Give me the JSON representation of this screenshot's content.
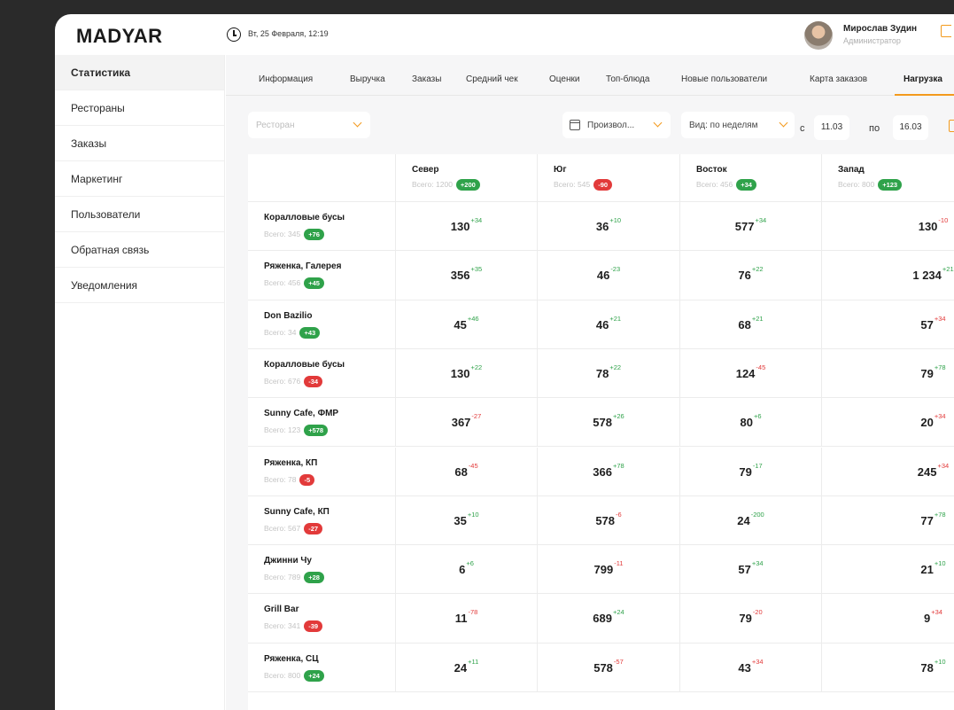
{
  "header": {
    "logo": "MADYAR",
    "date": "Вт, 25 Февраля, 12:19",
    "user_name": "Мирослав Зудин",
    "user_role": "Администратор"
  },
  "sidebar": {
    "items": [
      {
        "label": "Статистика",
        "active": true
      },
      {
        "label": "Рестораны"
      },
      {
        "label": "Заказы"
      },
      {
        "label": "Маркетинг"
      },
      {
        "label": "Пользователи"
      },
      {
        "label": "Обратная связь"
      },
      {
        "label": "Уведомления"
      }
    ]
  },
  "tabs": [
    "Информация",
    "Выручка",
    "Заказы",
    "Средний чек",
    "Оценки",
    "Топ-блюда",
    "Новые пользователи",
    "Карта заказов",
    "Нагрузка"
  ],
  "active_tab": "Нагрузка",
  "filters": {
    "restaurant_placeholder": "Ресторан",
    "period": "Произвол...",
    "view": "Вид: по неделям",
    "from_label": "с",
    "from": "11.03",
    "to_label": "по",
    "to": "16.03"
  },
  "columns": [
    {
      "name": "Север",
      "total": "Всего: 1200",
      "delta": "+200",
      "sign": "pos"
    },
    {
      "name": "Юг",
      "total": "Всего: 545",
      "delta": "-90",
      "sign": "neg"
    },
    {
      "name": "Восток",
      "total": "Всего: 456",
      "delta": "+34",
      "sign": "pos"
    },
    {
      "name": "Запад",
      "total": "Всего: 800",
      "delta": "+123",
      "sign": "pos"
    }
  ],
  "rows": [
    {
      "name": "Коралловые бусы",
      "total": "Всего: 345",
      "delta": "+76",
      "sign": "pos",
      "cells": [
        [
          "130",
          "+34",
          "pos"
        ],
        [
          "36",
          "+10",
          "pos"
        ],
        [
          "577",
          "+34",
          "pos"
        ],
        [
          "130",
          "-10",
          "neg"
        ]
      ]
    },
    {
      "name": "Ряженка, Галерея",
      "total": "Всего: 456",
      "delta": "+45",
      "sign": "pos",
      "cells": [
        [
          "356",
          "+35",
          "pos"
        ],
        [
          "46",
          "-23",
          "pos"
        ],
        [
          "76",
          "+22",
          "pos"
        ],
        [
          "1 234",
          "+21",
          "pos"
        ]
      ]
    },
    {
      "name": "Don Bazilio",
      "total": "Всего: 34",
      "delta": "+43",
      "sign": "pos",
      "cells": [
        [
          "45",
          "+46",
          "pos"
        ],
        [
          "46",
          "+21",
          "pos"
        ],
        [
          "68",
          "+21",
          "pos"
        ],
        [
          "57",
          "+34",
          "neg"
        ]
      ]
    },
    {
      "name": "Коралловые бусы",
      "total": "Всего: 676",
      "delta": "-34",
      "sign": "neg",
      "cells": [
        [
          "130",
          "+22",
          "pos"
        ],
        [
          "78",
          "+22",
          "pos"
        ],
        [
          "124",
          "-45",
          "neg"
        ],
        [
          "79",
          "+78",
          "pos"
        ]
      ]
    },
    {
      "name": "Sunny Cafe, ФМР",
      "total": "Всего: 123",
      "delta": "+578",
      "sign": "pos",
      "cells": [
        [
          "367",
          "-27",
          "neg"
        ],
        [
          "578",
          "+26",
          "pos"
        ],
        [
          "80",
          "+6",
          "pos"
        ],
        [
          "20",
          "+34",
          "neg"
        ]
      ]
    },
    {
      "name": "Ряженка, КП",
      "total": "Всего: 78",
      "delta": "-5",
      "sign": "neg",
      "cells": [
        [
          "68",
          "-45",
          "neg"
        ],
        [
          "366",
          "+78",
          "pos"
        ],
        [
          "79",
          "-17",
          "pos"
        ],
        [
          "245",
          "+34",
          "neg"
        ]
      ]
    },
    {
      "name": "Sunny Cafe, КП",
      "total": "Всего: 567",
      "delta": "-27",
      "sign": "neg",
      "cells": [
        [
          "35",
          "+10",
          "pos"
        ],
        [
          "578",
          "-6",
          "neg"
        ],
        [
          "24",
          "-200",
          "pos"
        ],
        [
          "77",
          "+78",
          "pos"
        ]
      ]
    },
    {
      "name": "Джинни Чу",
      "total": "Всего: 789",
      "delta": "+28",
      "sign": "pos",
      "cells": [
        [
          "6",
          "+6",
          "pos"
        ],
        [
          "799",
          "-11",
          "neg"
        ],
        [
          "57",
          "+34",
          "pos"
        ],
        [
          "21",
          "+10",
          "pos"
        ]
      ]
    },
    {
      "name": "Grill Bar",
      "total": "Всего: 341",
      "delta": "-39",
      "sign": "neg",
      "cells": [
        [
          "11",
          "-78",
          "neg"
        ],
        [
          "689",
          "+24",
          "pos"
        ],
        [
          "79",
          "-20",
          "neg"
        ],
        [
          "9",
          "+34",
          "neg"
        ]
      ]
    },
    {
      "name": "Ряженка, СЦ",
      "total": "Всего: 800",
      "delta": "+24",
      "sign": "pos",
      "cells": [
        [
          "24",
          "+11",
          "pos"
        ],
        [
          "578",
          "-57",
          "neg"
        ],
        [
          "43",
          "+34",
          "neg"
        ],
        [
          "78",
          "+10",
          "pos"
        ]
      ]
    }
  ]
}
